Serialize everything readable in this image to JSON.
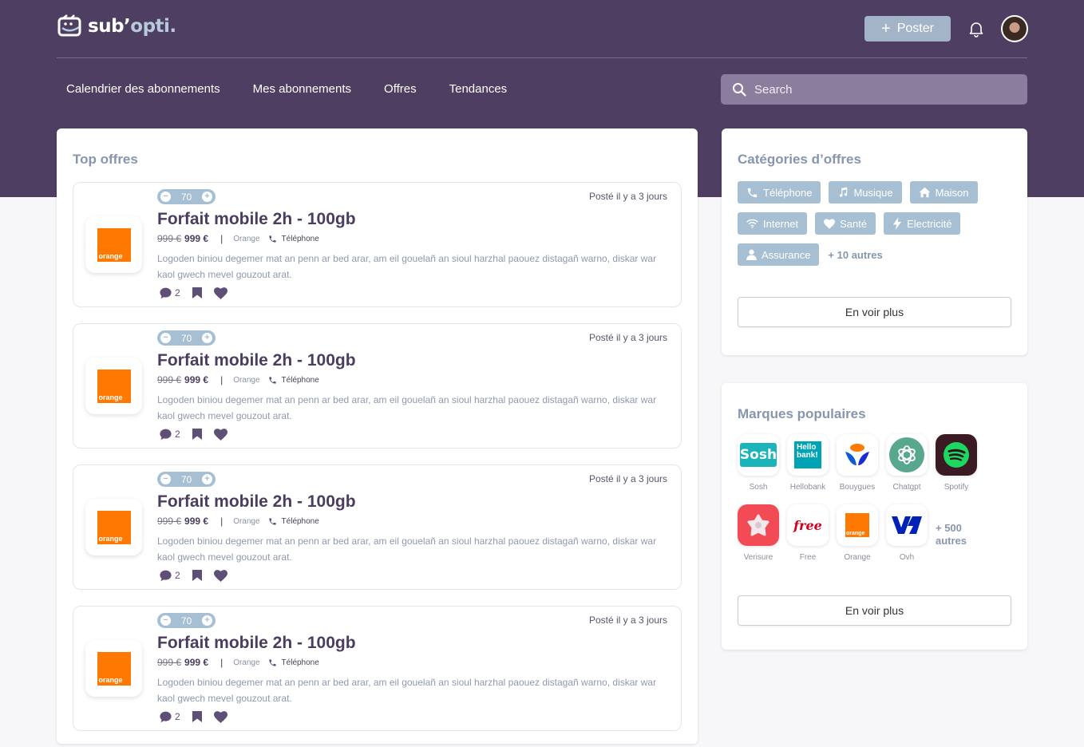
{
  "app": {
    "logo_text_part1": "sub’",
    "logo_text_part2": "opti."
  },
  "header": {
    "post_label": "Poster",
    "nav": [
      "Calendrier des abonnements",
      "Mes abonnements",
      "Offres",
      "Tendances"
    ],
    "search_placeholder": "Search"
  },
  "offers": {
    "title": "Top offres",
    "items": [
      {
        "votes": "70",
        "posted": "Posté il y a 3 jours",
        "title": "Forfait mobile 2h - 100gb",
        "old_price": "999 €",
        "new_price": "999 €",
        "brand": "Orange",
        "category": "Téléphone",
        "description": "Logoden biniou degemer mat an penn ar bed arar, am eil gouelañ an sioul  harzhal paouez distagañ warno, diskar war kaol gwech mevel gouzout arat.",
        "comments": "2",
        "logo_text": "orange"
      },
      {
        "votes": "70",
        "posted": "Posté il y a 3 jours",
        "title": "Forfait mobile 2h - 100gb",
        "old_price": "999 €",
        "new_price": "999 €",
        "brand": "Orange",
        "category": "Téléphone",
        "description": "Logoden biniou degemer mat an penn ar bed arar, am eil gouelañ an sioul  harzhal paouez distagañ warno, diskar war kaol gwech mevel gouzout arat.",
        "comments": "2",
        "logo_text": "orange"
      },
      {
        "votes": "70",
        "posted": "Posté il y a 3 jours",
        "title": "Forfait mobile 2h - 100gb",
        "old_price": "999 €",
        "new_price": "999 €",
        "brand": "Orange",
        "category": "Téléphone",
        "description": "Logoden biniou degemer mat an penn ar bed arar, am eil gouelañ an sioul  harzhal paouez distagañ warno, diskar war kaol gwech mevel gouzout arat.",
        "comments": "2",
        "logo_text": "orange"
      },
      {
        "votes": "70",
        "posted": "Posté il y a 3 jours",
        "title": "Forfait mobile 2h - 100gb",
        "old_price": "999 €",
        "new_price": "999 €",
        "brand": "Orange",
        "category": "Téléphone",
        "description": "Logoden biniou degemer mat an penn ar bed arar, am eil gouelañ an sioul  harzhal paouez distagañ warno, diskar war kaol gwech mevel gouzout arat.",
        "comments": "2",
        "logo_text": "orange"
      }
    ]
  },
  "categories": {
    "title": "Catégories d’offres",
    "chips": [
      {
        "label": "Téléphone",
        "icon": "phone-icon"
      },
      {
        "label": "Musique",
        "icon": "music-icon"
      },
      {
        "label": "Maison",
        "icon": "home-icon"
      },
      {
        "label": "Internet",
        "icon": "wifi-icon"
      },
      {
        "label": "Santé",
        "icon": "heart-icon"
      },
      {
        "label": "Electricité",
        "icon": "bolt-icon"
      },
      {
        "label": "Assurance",
        "icon": "user-icon"
      }
    ],
    "more": "+ 10 autres",
    "see_more": "En voir plus"
  },
  "brands": {
    "title": "Marques populaires",
    "items": [
      {
        "name": "Sosh",
        "logo_text": "Sosh"
      },
      {
        "name": "Hellobank",
        "logo_text": "Hello bank!"
      },
      {
        "name": "Bouygues",
        "logo_text": ""
      },
      {
        "name": "Chatgpt",
        "logo_text": ""
      },
      {
        "name": "Spotify",
        "logo_text": ""
      },
      {
        "name": "Verisure",
        "logo_text": ""
      },
      {
        "name": "Free",
        "logo_text": "free"
      },
      {
        "name": "Orange",
        "logo_text": "orange"
      },
      {
        "name": "Ovh",
        "logo_text": ""
      }
    ],
    "more_line1": "+ 500",
    "more_line2": "autres",
    "see_more": "En voir plus"
  },
  "colors": {
    "header_bg": "#4e3e62",
    "chip_bg": "#a6bfd3",
    "title_gray": "#8796ad",
    "text_dark": "#4a3d5e",
    "orange_brand": "#ff7900"
  }
}
